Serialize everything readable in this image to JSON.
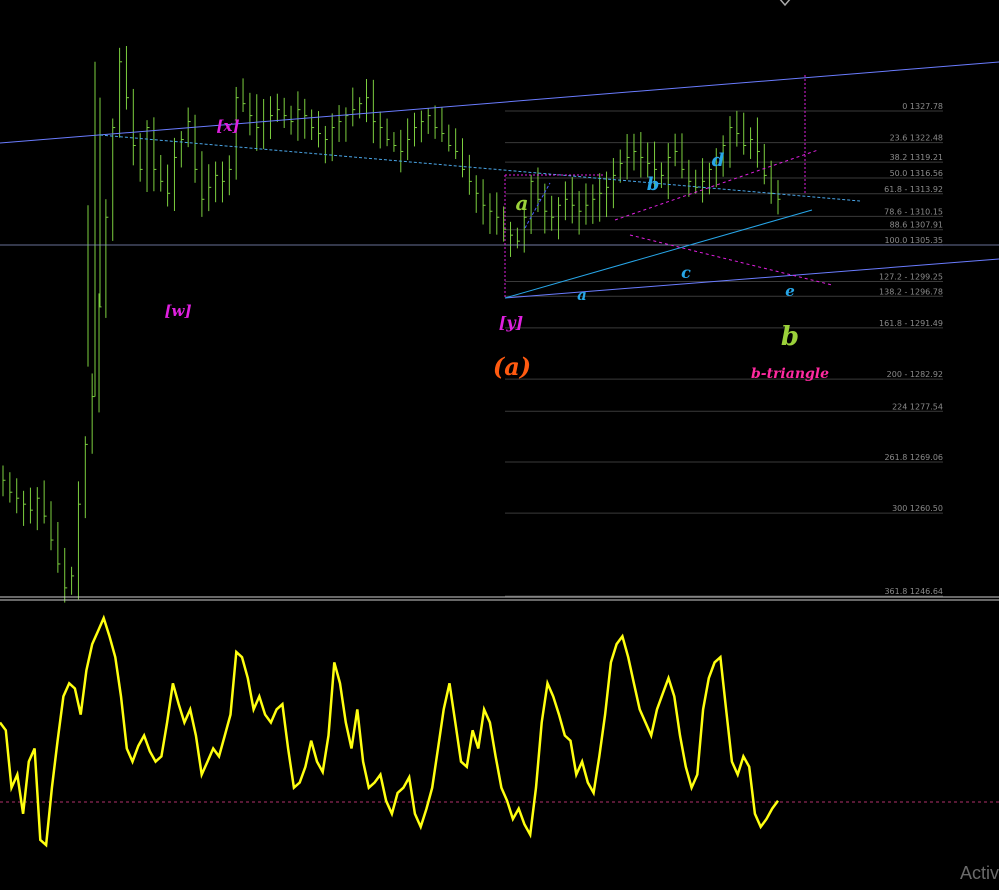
{
  "colors": {
    "background": "#000000",
    "candles": "#7ccf3f",
    "trendline": "#6a7cff",
    "fib_lines": "#3a3a3a",
    "magenta": "#e020e0",
    "cyan": "#27a6e8",
    "lime": "#9bd13a",
    "orange": "#ff5a10",
    "pink": "#ff2aa0",
    "oscillator": "#ffff10",
    "osc_level": "#b0306a"
  },
  "chart_data": [
    {
      "type": "candlestick",
      "ylim": [
        1246.64,
        1345
      ],
      "x_range": [
        0,
        130
      ],
      "close_series": [
        1266,
        1264,
        1263,
        1262,
        1261,
        1263,
        1260,
        1256,
        1252,
        1248,
        1250,
        1262,
        1272,
        1280,
        1295,
        1310,
        1325,
        1336,
        1330,
        1322,
        1318,
        1325,
        1318,
        1316,
        1314,
        1320,
        1323,
        1326,
        1318,
        1313,
        1315,
        1317,
        1316,
        1318,
        1330,
        1329,
        1327,
        1325,
        1326,
        1327,
        1328,
        1327,
        1326,
        1328,
        1327,
        1325,
        1324,
        1323,
        1325,
        1326,
        1327,
        1328,
        1329,
        1330,
        1326,
        1325,
        1323,
        1322,
        1321,
        1323,
        1325,
        1326,
        1327,
        1325,
        1324,
        1322,
        1321,
        1318,
        1316,
        1314,
        1312,
        1311,
        1310,
        1308,
        1307,
        1306,
        1310,
        1316,
        1313,
        1311,
        1310,
        1312,
        1313,
        1312,
        1311,
        1312,
        1313,
        1314,
        1315,
        1317,
        1319,
        1320,
        1321,
        1320,
        1319,
        1318,
        1317,
        1320,
        1321,
        1318,
        1316,
        1315,
        1316,
        1318,
        1320,
        1322,
        1325,
        1324,
        1322,
        1323,
        1321,
        1317,
        1314,
        1313
      ],
      "horizontal_line": 1314.9
    },
    {
      "type": "line",
      "name": "",
      "level": 20,
      "ylim": [
        0,
        100
      ],
      "values": [
        55,
        52,
        30,
        35,
        20,
        40,
        45,
        10,
        8,
        30,
        48,
        65,
        70,
        68,
        58,
        75,
        85,
        90,
        95,
        88,
        80,
        65,
        45,
        40,
        46,
        50,
        44,
        40,
        42,
        55,
        70,
        62,
        55,
        60,
        50,
        35,
        40,
        45,
        42,
        50,
        58,
        82,
        80,
        72,
        60,
        65,
        58,
        55,
        60,
        62,
        45,
        30,
        32,
        38,
        48,
        40,
        36,
        50,
        78,
        70,
        55,
        45,
        60,
        40,
        30,
        32,
        35,
        25,
        20,
        28,
        30,
        34,
        20,
        15,
        22,
        30,
        45,
        60,
        70,
        55,
        40,
        38,
        52,
        45,
        60,
        55,
        42,
        30,
        25,
        18,
        22,
        16,
        12,
        30,
        55,
        70,
        65,
        58,
        50,
        48,
        35,
        40,
        32,
        28,
        42,
        58,
        78,
        85,
        88,
        80,
        70,
        60,
        55,
        50,
        60,
        66,
        72,
        65,
        50,
        38,
        30,
        35,
        60,
        72,
        78,
        80,
        60,
        40,
        35,
        42,
        38,
        20,
        15,
        18,
        22,
        25
      ]
    }
  ],
  "fib_levels": [
    {
      "label": "0 1327.78",
      "value": 1327.78
    },
    {
      "label": "23.6 1322.48",
      "value": 1322.48
    },
    {
      "label": "38.2 1319.21",
      "value": 1319.21
    },
    {
      "label": "50.0 1316.56",
      "value": 1316.56
    },
    {
      "label": "61.8 - 1313.92",
      "value": 1313.92
    },
    {
      "label": "78.6 - 1310.15",
      "value": 1310.15
    },
    {
      "label": "88.6 1307.91",
      "value": 1307.91
    },
    {
      "label": "100.0 1305.35",
      "value": 1305.35
    },
    {
      "label": "127.2 - 1299.25",
      "value": 1299.25
    },
    {
      "label": "138.2 - 1296.78",
      "value": 1296.78
    },
    {
      "label": "161.8 - 1291.49",
      "value": 1291.49
    },
    {
      "label": "200 - 1282.92",
      "value": 1282.92
    },
    {
      "label": "224 1277.54",
      "value": 1277.54
    },
    {
      "label": "261.8 1269.06",
      "value": 1269.06
    },
    {
      "label": "300 1260.50",
      "value": 1260.5
    },
    {
      "label": "361.8 1246.64",
      "value": 1246.64
    }
  ],
  "annotations": {
    "x_label": "[x]",
    "w_label": "[w]",
    "y_label": "[y]",
    "a_big_label": "(a)",
    "a_green": "a",
    "b_green": "b",
    "triangle_label": "b-triangle",
    "tri_a": "a",
    "tri_b": "b",
    "tri_c": "c",
    "tri_d": "d",
    "tri_e": "e"
  },
  "watermark": "Activ"
}
